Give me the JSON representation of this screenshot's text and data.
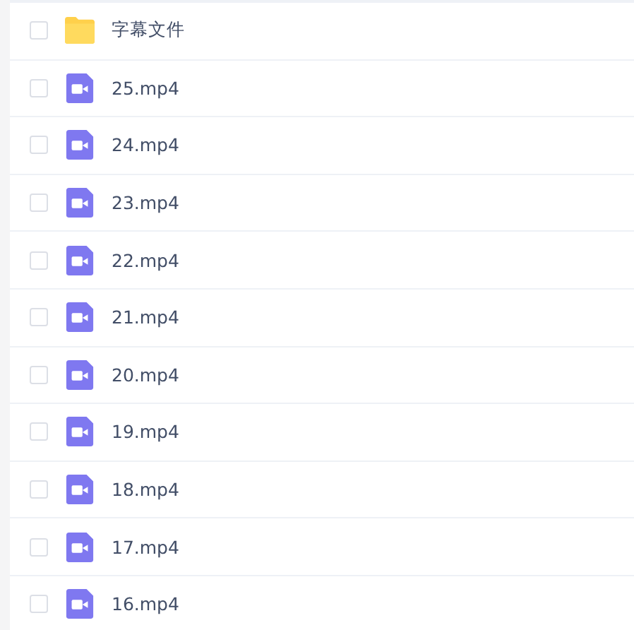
{
  "files": [
    {
      "kind": "folder",
      "name": "字幕文件",
      "checked": false
    },
    {
      "kind": "video",
      "name": "25.mp4",
      "checked": false
    },
    {
      "kind": "video",
      "name": "24.mp4",
      "checked": false
    },
    {
      "kind": "video",
      "name": "23.mp4",
      "checked": false
    },
    {
      "kind": "video",
      "name": "22.mp4",
      "checked": false
    },
    {
      "kind": "video",
      "name": "21.mp4",
      "checked": false
    },
    {
      "kind": "video",
      "name": "20.mp4",
      "checked": false
    },
    {
      "kind": "video",
      "name": "19.mp4",
      "checked": false
    },
    {
      "kind": "video",
      "name": "18.mp4",
      "checked": false
    },
    {
      "kind": "video",
      "name": "17.mp4",
      "checked": false
    },
    {
      "kind": "video",
      "name": "16.mp4",
      "checked": false
    }
  ]
}
